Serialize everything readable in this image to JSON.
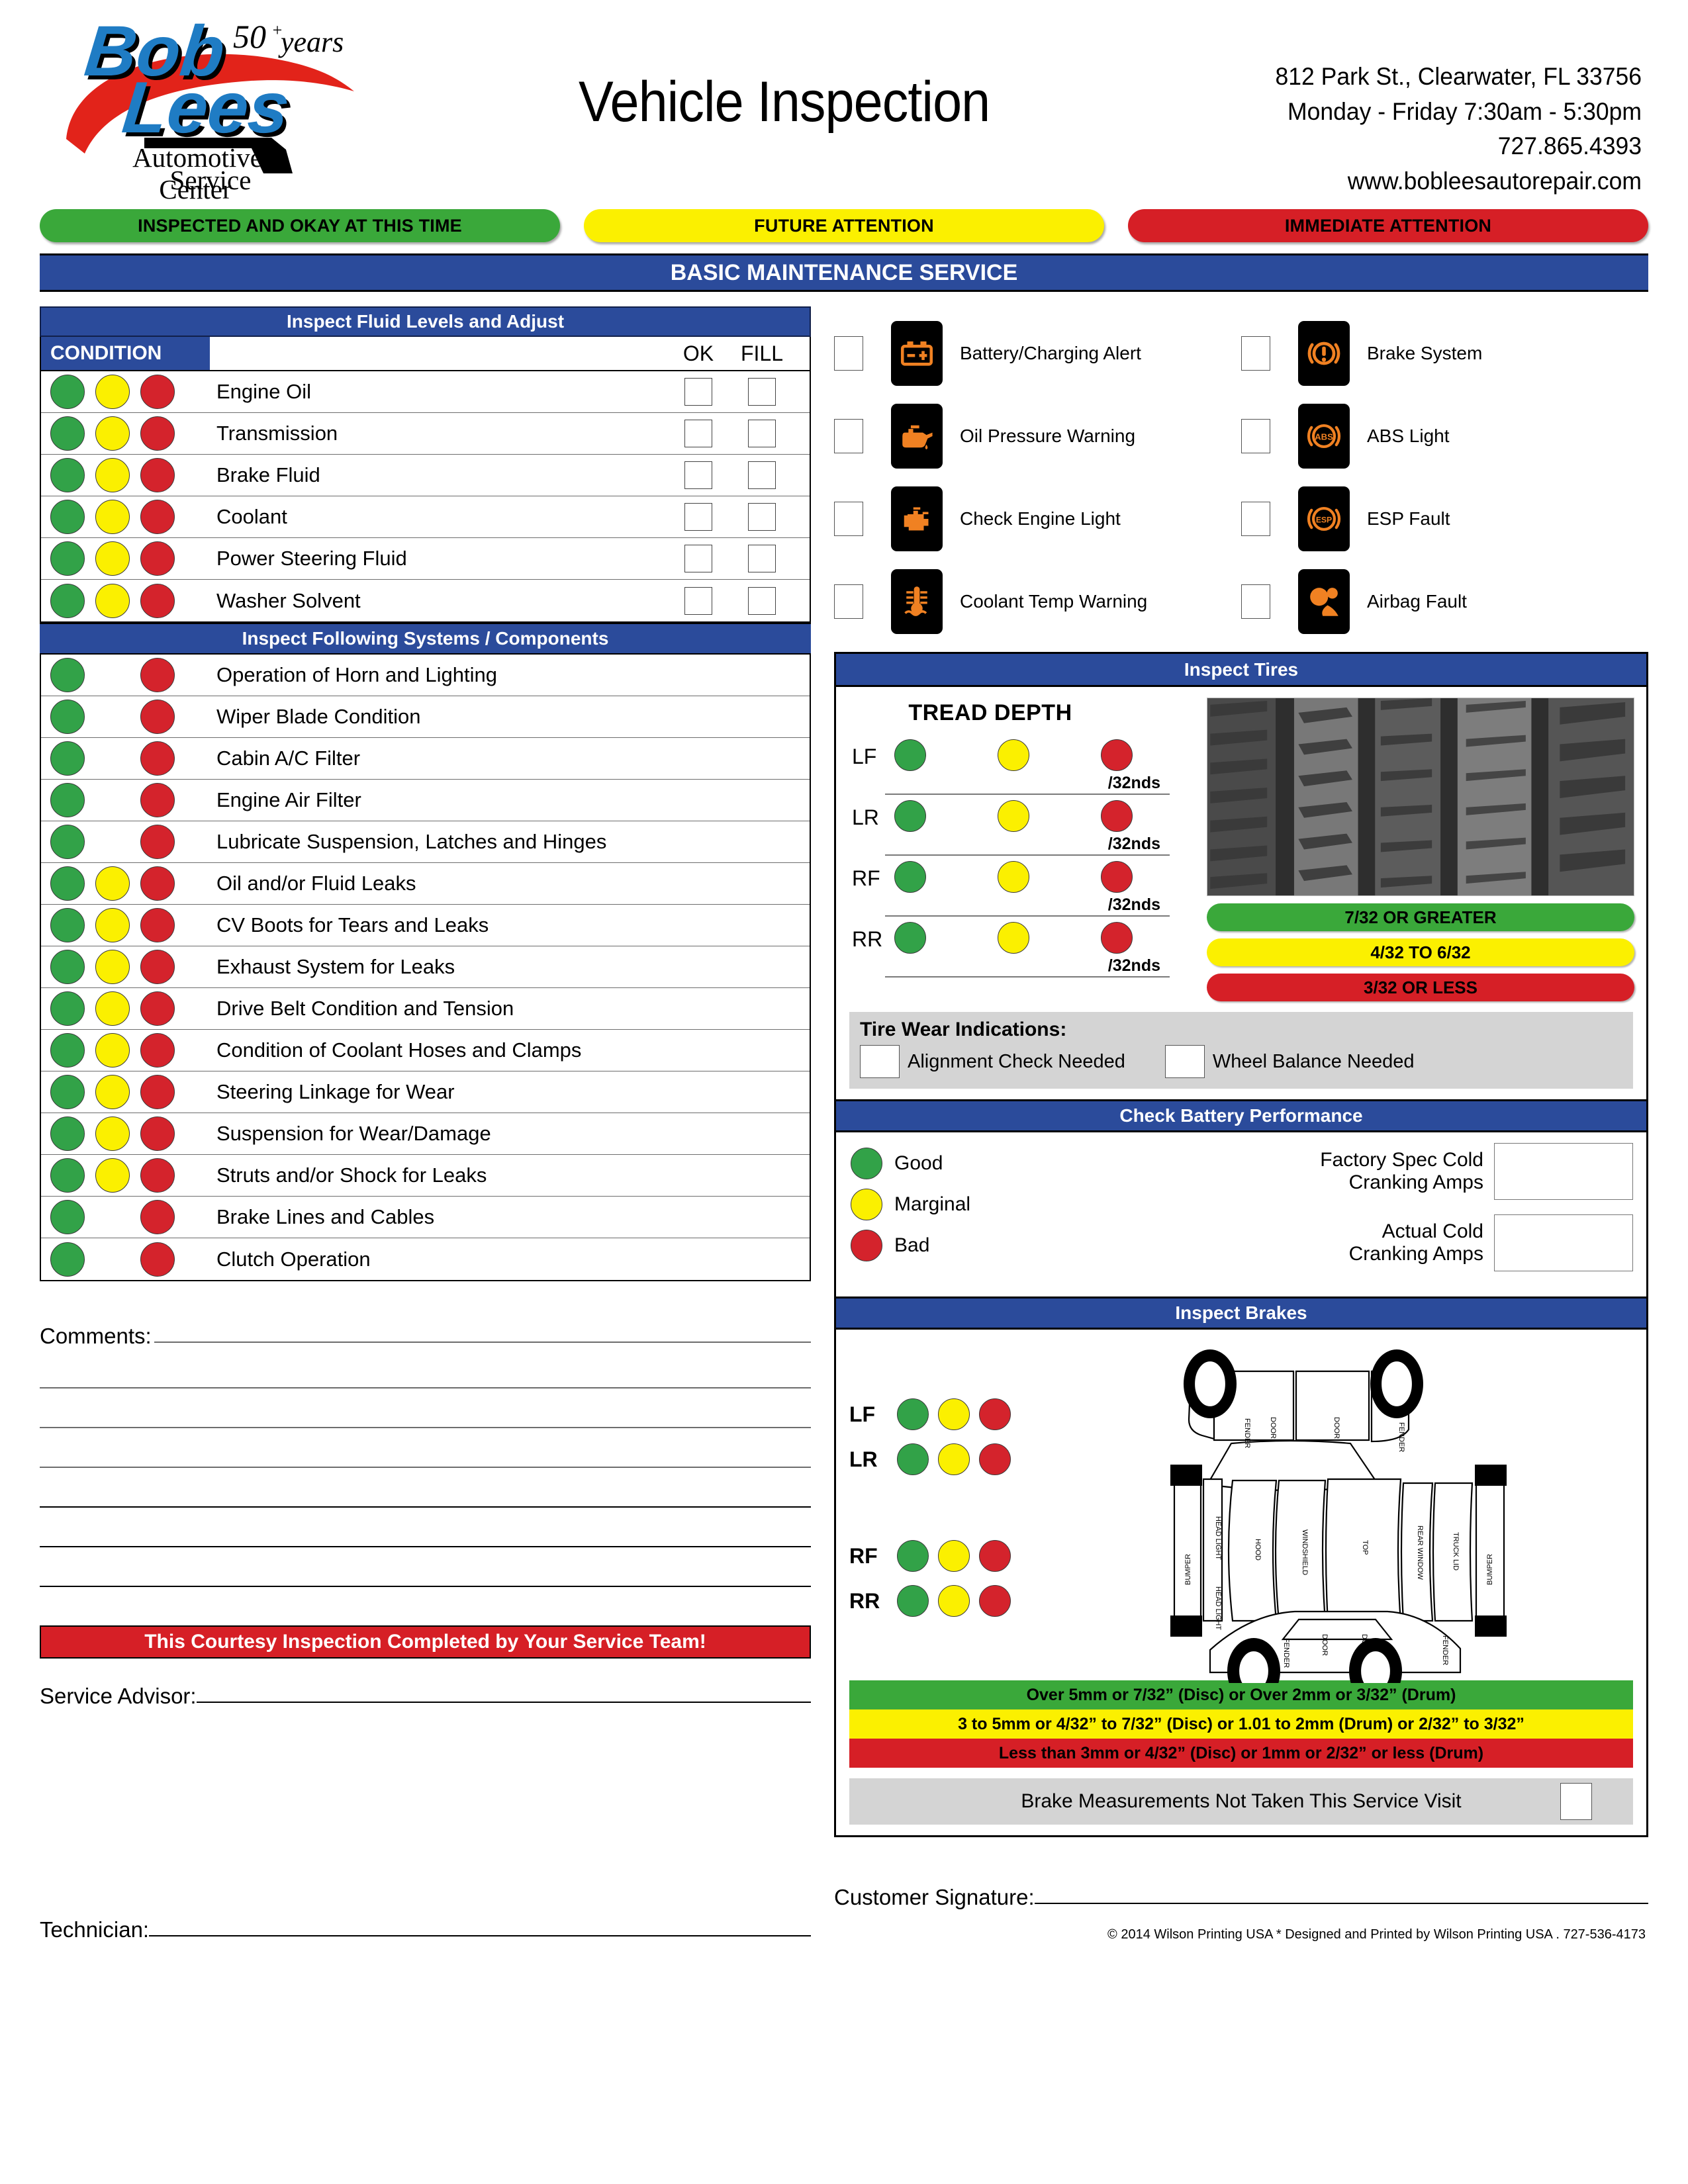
{
  "header": {
    "logo": {
      "line1": "Bob",
      "line2": "Lees",
      "years": "50",
      "years_sup": "+",
      "years_word": "years",
      "sub1": "Automotive",
      "sub2": "Service",
      "sub3": "Center"
    },
    "title": "Vehicle Inspection",
    "address": "812 Park St., Clearwater, FL 33756",
    "hours": "Monday - Friday  7:30am - 5:30pm",
    "phone": "727.865.4393",
    "website": "www.bobleesautorepair.com"
  },
  "legend": [
    {
      "label": "INSPECTED AND OKAY AT THIS TIME",
      "color": "#3aa83a",
      "class": "green"
    },
    {
      "label": "FUTURE ATTENTION",
      "color": "#fbf000",
      "class": "yellow"
    },
    {
      "label": "IMMEDIATE ATTENTION",
      "color": "#d61f26",
      "class": "red"
    }
  ],
  "main_band": "BASIC MAINTENANCE SERVICE",
  "fluids": {
    "title": "Inspect Fluid Levels and Adjust",
    "condition_label": "CONDITION",
    "col_ok": "OK",
    "col_fill": "FILL",
    "rows": [
      {
        "label": "Engine Oil",
        "dots": [
          "g",
          "y",
          "r"
        ]
      },
      {
        "label": "Transmission",
        "dots": [
          "g",
          "y",
          "r"
        ]
      },
      {
        "label": "Brake Fluid",
        "dots": [
          "g",
          "y",
          "r"
        ]
      },
      {
        "label": "Coolant",
        "dots": [
          "g",
          "y",
          "r"
        ]
      },
      {
        "label": "Power Steering Fluid",
        "dots": [
          "g",
          "y",
          "r"
        ]
      },
      {
        "label": "Washer Solvent",
        "dots": [
          "g",
          "y",
          "r"
        ]
      }
    ]
  },
  "systems": {
    "title": "Inspect Following Systems / Components",
    "rows": [
      {
        "label": "Operation of Horn and Lighting",
        "dots": [
          "g",
          "blank",
          "r"
        ]
      },
      {
        "label": "Wiper Blade Condition",
        "dots": [
          "g",
          "blank",
          "r"
        ]
      },
      {
        "label": "Cabin A/C Filter",
        "dots": [
          "g",
          "blank",
          "r"
        ]
      },
      {
        "label": "Engine Air Filter",
        "dots": [
          "g",
          "blank",
          "r"
        ]
      },
      {
        "label": "Lubricate Suspension, Latches and Hinges",
        "dots": [
          "g",
          "blank",
          "r"
        ]
      },
      {
        "label": "Oil and/or Fluid Leaks",
        "dots": [
          "g",
          "y",
          "r"
        ]
      },
      {
        "label": "CV Boots for Tears and Leaks",
        "dots": [
          "g",
          "y",
          "r"
        ]
      },
      {
        "label": "Exhaust System for Leaks",
        "dots": [
          "g",
          "y",
          "r"
        ]
      },
      {
        "label": "Drive Belt Condition and Tension",
        "dots": [
          "g",
          "y",
          "r"
        ]
      },
      {
        "label": "Condition of Coolant Hoses and Clamps",
        "dots": [
          "g",
          "y",
          "r"
        ]
      },
      {
        "label": "Steering Linkage for Wear",
        "dots": [
          "g",
          "y",
          "r"
        ]
      },
      {
        "label": "Suspension for Wear/Damage",
        "dots": [
          "g",
          "y",
          "r"
        ]
      },
      {
        "label": "Struts and/or Shock for Leaks",
        "dots": [
          "g",
          "y",
          "r"
        ]
      },
      {
        "label": "Brake Lines and Cables",
        "dots": [
          "g",
          "blank",
          "r"
        ]
      },
      {
        "label": "Clutch Operation",
        "dots": [
          "g",
          "blank",
          "r"
        ]
      }
    ]
  },
  "warning_lights": [
    {
      "label": "Battery/Charging Alert",
      "icon": "battery-icon"
    },
    {
      "label": "Brake System",
      "icon": "brake-system-icon"
    },
    {
      "label": "Oil Pressure Warning",
      "icon": "oil-can-icon"
    },
    {
      "label": "ABS Light",
      "icon": "abs-icon"
    },
    {
      "label": "Check Engine Light",
      "icon": "engine-icon"
    },
    {
      "label": "ESP Fault",
      "icon": "esp-icon"
    },
    {
      "label": "Coolant Temp Warning",
      "icon": "coolant-temp-icon"
    },
    {
      "label": "Airbag Fault",
      "icon": "airbag-icon"
    }
  ],
  "tires": {
    "title": "Inspect Tires",
    "tread_title": "TREAD DEPTH",
    "unit": "/32nds",
    "positions": [
      "LF",
      "LR",
      "RF",
      "RR"
    ],
    "scale": [
      {
        "label": "7/32 OR GREATER",
        "class": "green"
      },
      {
        "label": "4/32 TO 6/32",
        "class": "yellow"
      },
      {
        "label": "3/32 OR LESS",
        "class": "red"
      }
    ],
    "wear_title": "Tire Wear Indications:",
    "wear_options": [
      "Alignment Check Needed",
      "Wheel Balance Needed"
    ]
  },
  "battery": {
    "title": "Check Battery Performance",
    "legend": [
      {
        "label": "Good",
        "class": "g"
      },
      {
        "label": "Marginal",
        "class": "y"
      },
      {
        "label": "Bad",
        "class": "r"
      }
    ],
    "fields": [
      {
        "line1": "Factory Spec Cold",
        "line2": "Cranking Amps",
        "value": ""
      },
      {
        "line1": "Actual Cold",
        "line2": "Cranking Amps",
        "value": ""
      }
    ]
  },
  "brakes": {
    "title": "Inspect Brakes",
    "positions": [
      "LF",
      "LR",
      "RF",
      "RR"
    ],
    "scale": [
      {
        "label": "Over 5mm or 7/32” (Disc) or Over 2mm or 3/32” (Drum)",
        "class": "green"
      },
      {
        "label": "3 to 5mm or 4/32” to 7/32” (Disc) or 1.01 to 2mm (Drum) or 2/32” to 3/32”",
        "class": "yellow"
      },
      {
        "label": "Less than 3mm or 4/32” (Disc) or 1mm or 2/32” or less (Drum)",
        "class": "red"
      }
    ],
    "note": "Brake Measurements Not Taken This Service Visit",
    "diagram_labels": [
      "FENDER",
      "DOOR",
      "DOOR",
      "FENDER",
      "BUMPER",
      "HEAD LIGHT",
      "HEAD LIGHT",
      "HOOD",
      "WINDSHIELD",
      "TOP",
      "REAR WINDOW",
      "TRUCK LID",
      "BUMPER",
      "FENDER",
      "FENDER",
      "DOOR",
      "DOOR"
    ]
  },
  "footer": {
    "comments_label": "Comments:",
    "courtesy": "This Courtesy Inspection Completed by Your Service Team!",
    "service_advisor": "Service Advisor:",
    "technician": "Technician:",
    "customer_signature": "Customer Signature:",
    "copyright": "© 2014 Wilson Printing USA  * Designed and Printed by Wilson Printing USA . 727-536-4173"
  }
}
